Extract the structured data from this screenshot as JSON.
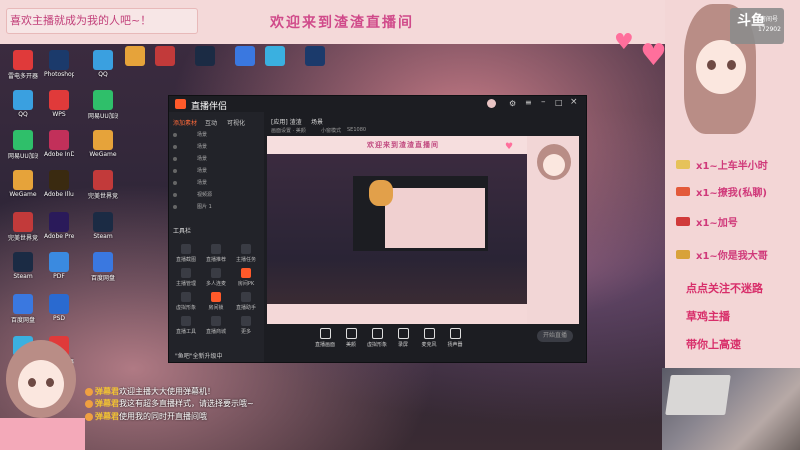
{
  "banner": {
    "left_text": "喜欢主播就成为我的人吧~！",
    "title": "欢迎来到渣渣直播间"
  },
  "right_panel": {
    "brand": "斗鱼",
    "brand_sub": "房间号",
    "room_id": "172902",
    "lines": [
      "x1~上车半小时",
      "x1~撩我(私聊)",
      "x1~加号",
      "x1~你是我大哥"
    ],
    "slogans": [
      "点点关注不迷路",
      "草鸡主播",
      "带你上高速"
    ]
  },
  "desktop_icons": [
    {
      "label": "雷电多开器",
      "color": "#e03a3a"
    },
    {
      "label": "QQ",
      "color": "#3aa0e0"
    },
    {
      "label": "网易UU加速",
      "color": "#2fbf6a"
    },
    {
      "label": "WeGame",
      "color": "#e6a33a"
    },
    {
      "label": "完美世界竞技",
      "color": "#c23a3a"
    },
    {
      "label": "Steam",
      "color": "#1b2b44"
    },
    {
      "label": "百度网盘",
      "color": "#3a78e0"
    },
    {
      "label": "360安全",
      "color": "#3ab0e0"
    },
    {
      "label": "Photoshop",
      "color": "#1b3a6b"
    },
    {
      "label": "WPS",
      "color": "#e03a3a"
    },
    {
      "label": "Adobe InDe",
      "color": "#c2305a"
    },
    {
      "label": "Adobe Illustr",
      "color": "#3a2a10"
    },
    {
      "label": "Adobe Premi",
      "color": "#2a1a5a"
    },
    {
      "label": "PDF",
      "color": "#3a8ae0"
    },
    {
      "label": "PSD",
      "color": "#2a6ad0"
    }
  ],
  "app": {
    "name": "直播伴侣",
    "side_tabs": [
      "添加素材",
      "互动",
      "可视化"
    ],
    "scenes": [
      "场景",
      "场景",
      "场景",
      "场景",
      "场景",
      "视频源",
      "图片 1"
    ],
    "tools_title": "工具栏",
    "tools": [
      "直播截图",
      "直播推荐",
      "主播任务",
      "主播管理",
      "多人连麦",
      "房间PK",
      "虚拟形象",
      "房间锁",
      "直播助手",
      "直播工具",
      "直播商城",
      "更多"
    ],
    "bottom_tools": [
      "直播画面",
      "美颜",
      "虚拟形象",
      "录屏",
      "麦克风",
      "扬声器"
    ],
    "start_live": "开始直播",
    "footer_hint": "\"鱼吧\"全新升级中",
    "preview_tabs": [
      "[应用] 渣渣",
      "场景"
    ],
    "preview_sub": [
      "画面设置 · 美颜",
      "小窗模式",
      "SE1080"
    ]
  },
  "nested": {
    "title": "欢迎来到渣渣直播间"
  },
  "chat": [
    {
      "name": "弹幕君",
      "text": "欢迎主播大大使用弹幕机！"
    },
    {
      "name": "弹幕君",
      "text": "我这有超多直播样式，请选择要示哦~"
    },
    {
      "name": "弹幕君",
      "text": "使用我的同时开直播间哦"
    }
  ]
}
